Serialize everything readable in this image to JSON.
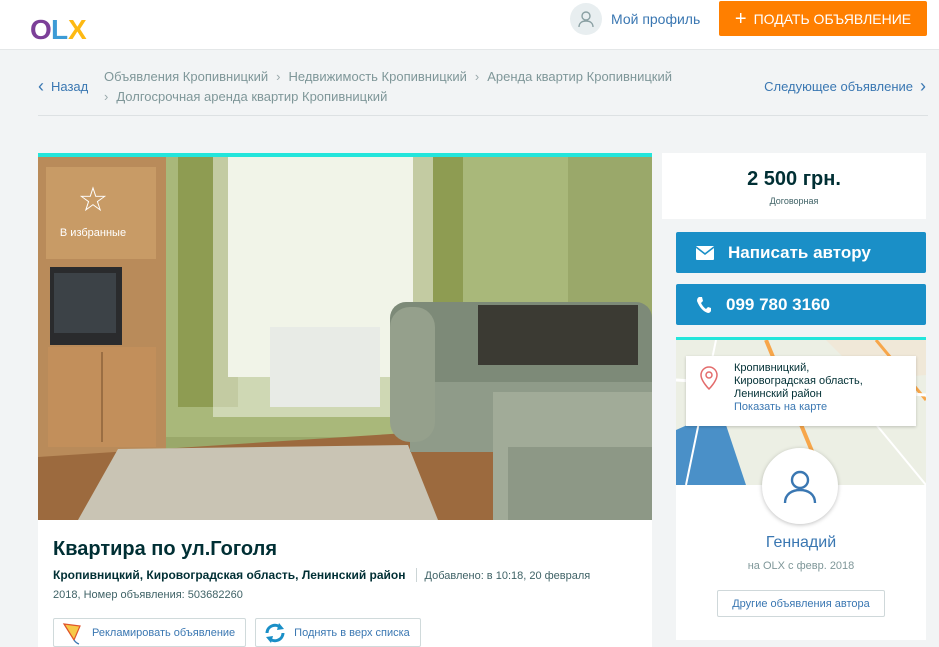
{
  "header": {
    "logo_letters": [
      "O",
      "L",
      "X"
    ],
    "logo_colors": [
      "#7c3f98",
      "#3c9bd6",
      "#fdb913"
    ],
    "profile_label": "Мой профиль",
    "profile_icon": "user-icon",
    "post_button_label": "ПОДАТЬ ОБЪЯВЛЕНИЕ",
    "post_button_icon": "plus-icon",
    "post_button_color": "#ff7f00"
  },
  "breadcrumb": {
    "back_label": "Назад",
    "items": [
      "Объявления Кропивницкий",
      "Недвижимость Кропивницкий",
      "Аренда квартир Кропивницкий",
      "Долгосрочная аренда квартир Кропивницкий"
    ],
    "next_label": "Следующее объявление"
  },
  "listing": {
    "favorite_label": "В избранные",
    "title": "Квартира по ул.Гоголя",
    "location": "Кропивницкий, Кировоградская область, Ленинский район",
    "added_line1": "Добавлено: в 10:18, 20 февраля",
    "added_line2": "2018, Номер объявления: 503682260",
    "promote_label": "Рекламировать объявление",
    "promote_icon": "kite-icon",
    "raise_label": "Поднять в верх списка",
    "raise_icon": "refresh-icon",
    "accent_color": "#23e5db"
  },
  "sidebar": {
    "price": "2 500 грн.",
    "price_note": "Договорная",
    "message_label": "Написать автору",
    "message_icon": "envelope-icon",
    "phone_label": "099 780 3160",
    "phone_icon": "phone-icon",
    "button_color": "#1a8fc7",
    "address_line1": "Кропивницкий,",
    "address_line2": "Кировоградская область,",
    "address_line3": "Ленинский район",
    "map_link": "Показать на карте",
    "seller_name": "Геннадий",
    "seller_since": "на OLX с февр. 2018",
    "other_ads_label": "Другие объявления автора"
  }
}
